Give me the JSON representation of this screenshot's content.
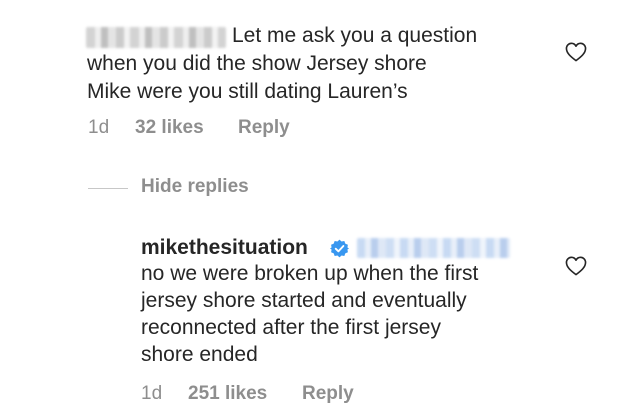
{
  "comment": {
    "line1": "Let me ask you a question",
    "line2": "when you did the show Jersey shore",
    "line3": "Mike were you still dating Lauren’s",
    "age": "1d",
    "likes": "32 likes",
    "reply_label": "Reply"
  },
  "thread": {
    "hide_replies_label": "Hide replies"
  },
  "reply": {
    "username": "mikethesituation",
    "line1": "no we were broken up when the first",
    "line2": "jersey shore started and eventually",
    "line3": "reconnected after the first jersey",
    "line4": "shore ended",
    "age": "1d",
    "likes": "251 likes",
    "reply_label": "Reply"
  },
  "icons": {
    "like": "heart-outline-icon",
    "verified": "verified-badge-icon"
  },
  "colors": {
    "text": "#262626",
    "secondary": "#8e8e8e",
    "verified_blue": "#3897f0"
  }
}
